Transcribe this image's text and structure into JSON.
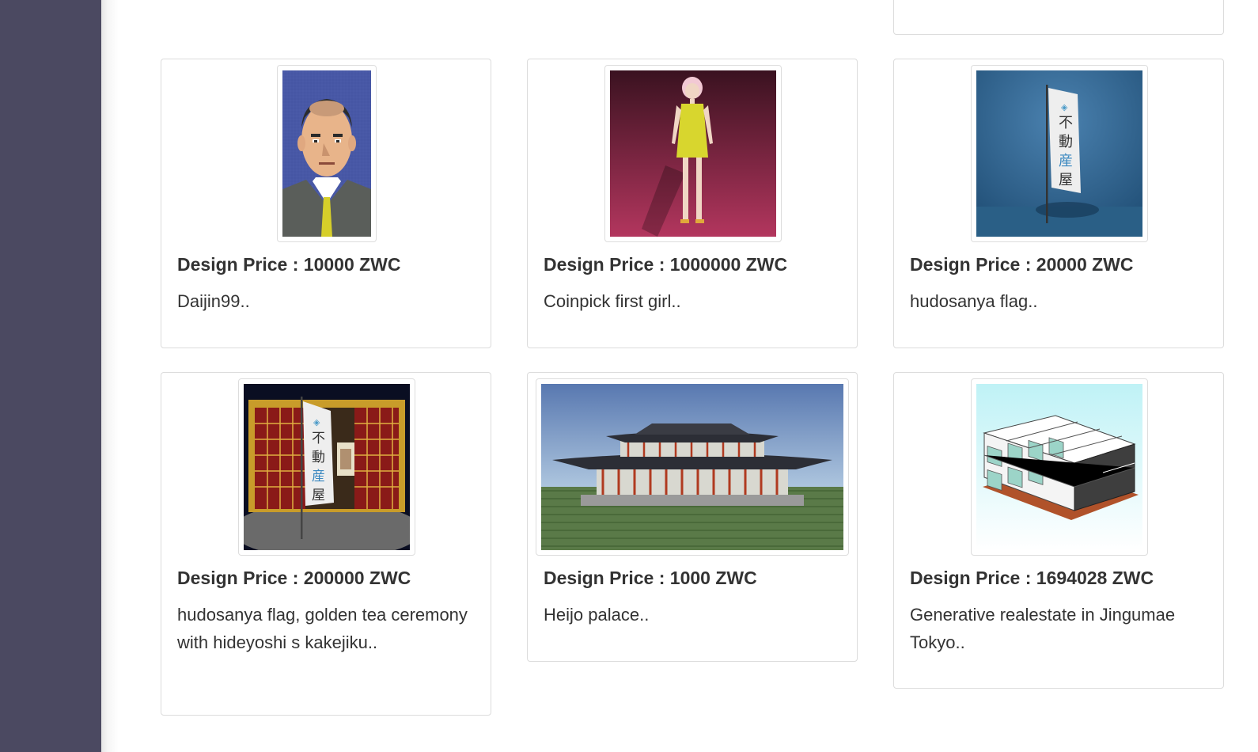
{
  "cards": [
    {
      "price": "Design Price : 10000 ZWC",
      "description": "Daijin99..",
      "image": "pixel-portrait-man"
    },
    {
      "price": "Design Price : 1000000 ZWC",
      "description": "Coinpick first girl..",
      "image": "3d-girl-yellow-dress"
    },
    {
      "price": "Design Price : 20000 ZWC",
      "description": "hudosanya flag..",
      "image": "flag-blue-room"
    },
    {
      "price": "Design Price : 200000 ZWC",
      "description": "hudosanya flag, golden tea ceremony with hideyoshi s kakejiku..",
      "image": "golden-tea-room-flag"
    },
    {
      "price": "Design Price : 1000 ZWC",
      "description": "Heijo palace..",
      "image": "heijo-palace"
    },
    {
      "price": "Design Price : 1694028 ZWC",
      "description": "Generative realestate in Jingumae Tokyo..",
      "image": "isometric-buildings"
    }
  ],
  "flag_text": [
    "不",
    "動",
    "産",
    "屋"
  ]
}
